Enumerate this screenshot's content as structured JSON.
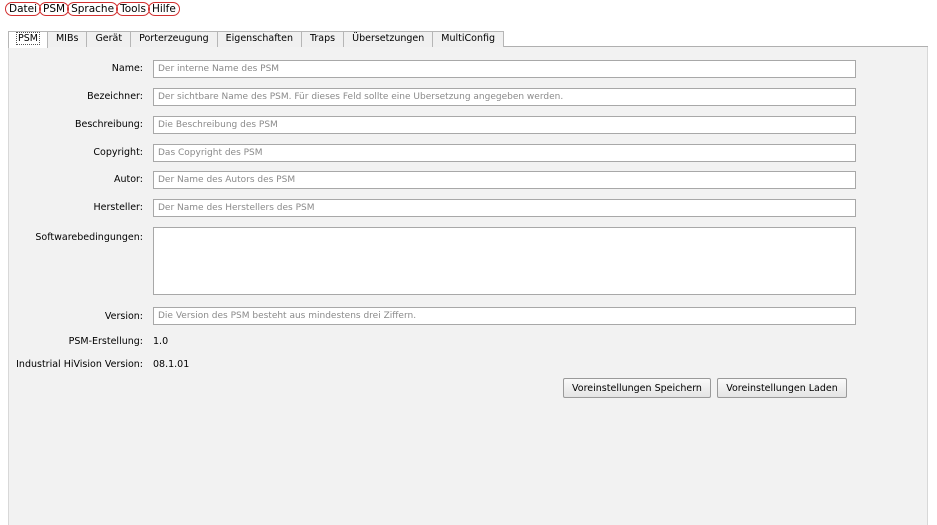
{
  "menu": [
    "Datei",
    "PSM",
    "Sprache",
    "Tools",
    "Hilfe"
  ],
  "tabs": [
    "PSM",
    "MIBs",
    "Gerät",
    "Porterzeugung",
    "Eigenschaften",
    "Traps",
    "Übersetzungen",
    "MultiConfig"
  ],
  "form": {
    "name": {
      "label": "Name:",
      "placeholder": "Der interne Name des PSM"
    },
    "bezeichner": {
      "label": "Bezeichner:",
      "placeholder": "Der sichtbare Name des PSM. Für dieses Feld sollte eine Übersetzung angegeben werden."
    },
    "beschreibung": {
      "label": "Beschreibung:",
      "placeholder": "Die Beschreibung des PSM"
    },
    "copyright": {
      "label": "Copyright:",
      "placeholder": "Das Copyright des PSM"
    },
    "autor": {
      "label": "Autor:",
      "placeholder": "Der Name des Autors des PSM"
    },
    "hersteller": {
      "label": "Hersteller:",
      "placeholder": "Der Name des Herstellers des PSM"
    },
    "softwarebedingungen": {
      "label": "Softwarebedingungen:"
    },
    "version": {
      "label": "Version:",
      "placeholder": "Die Version des PSM besteht aus mindestens drei Ziffern."
    },
    "psm_erstellung": {
      "label": "PSM-Erstellung:",
      "value": "1.0"
    },
    "hivision_version": {
      "label": "Industrial HiVision Version:",
      "value": "08.1.01"
    }
  },
  "buttons": {
    "save_defaults": "Voreinstellungen Speichern",
    "load_defaults": "Voreinstellungen Laden"
  }
}
